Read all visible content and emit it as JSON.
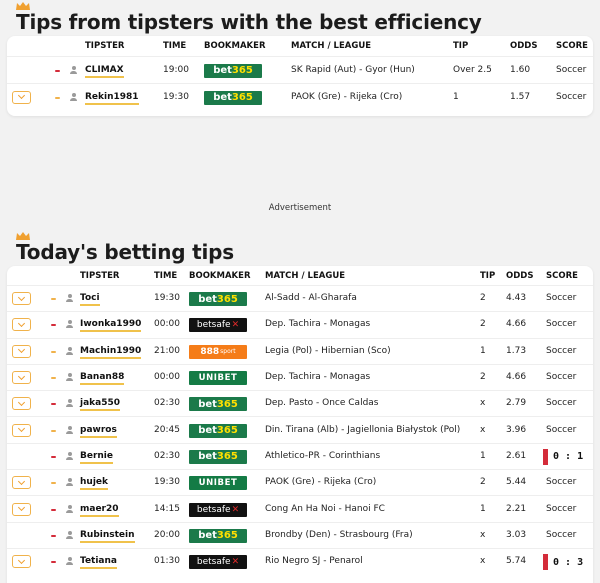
{
  "colors": {
    "accent": "#f0b24b",
    "underline": "#f0c24b",
    "trend_down": "#d42c3a",
    "bet365": "#1b7a4a",
    "betsafe": "#111111",
    "b888": "#f57c18",
    "unibet": "#147b45",
    "score_bar": "#d42c3a"
  },
  "top": {
    "title": "Tips from tipsters with the best efficiency",
    "headers": {
      "tipster": "TIPSTER",
      "time": "TIME",
      "bookmaker": "BOOKMAKER",
      "match": "MATCH / LEAGUE",
      "tip": "TIP",
      "odds": "ODDS",
      "score": "SCORE"
    },
    "rows": [
      {
        "follow": false,
        "trend": "down",
        "tipster": "CLIMAX",
        "time": "19:00",
        "bookmaker": "bet365",
        "match": "SK Rapid (Aut) - Gyor (Hun)",
        "tip": "Over 2.5",
        "odds": "1.60",
        "score": "Soccer",
        "score_result": ""
      },
      {
        "follow": true,
        "trend": "up",
        "tipster": "Rekin1981",
        "time": "19:30",
        "bookmaker": "bet365",
        "match": "PAOK (Gre) - Rijeka (Cro)",
        "tip": "1",
        "odds": "1.57",
        "score": "Soccer",
        "score_result": ""
      }
    ]
  },
  "advertisement": "Advertisement",
  "today": {
    "title": "Today's betting tips",
    "headers": {
      "tipster": "TIPSTER",
      "time": "TIME",
      "bookmaker": "BOOKMAKER",
      "match": "MATCH / LEAGUE",
      "tip": "TIP",
      "odds": "ODDS",
      "score": "SCORE"
    },
    "rows": [
      {
        "follow": true,
        "trend": "up",
        "tipster": "Toci",
        "time": "19:30",
        "bookmaker": "bet365",
        "match": "Al-Sadd - Al-Gharafa",
        "tip": "2",
        "odds": "4.43",
        "score": "Soccer",
        "score_result": ""
      },
      {
        "follow": true,
        "trend": "down",
        "tipster": "Iwonka1990",
        "time": "00:00",
        "bookmaker": "betsafe",
        "match": "Dep. Tachira - Monagas",
        "tip": "2",
        "odds": "4.66",
        "score": "Soccer",
        "score_result": ""
      },
      {
        "follow": true,
        "trend": "up",
        "tipster": "Machin1990",
        "time": "21:00",
        "bookmaker": "888",
        "match": "Legia (Pol) - Hibernian (Sco)",
        "tip": "1",
        "odds": "1.73",
        "score": "Soccer",
        "score_result": ""
      },
      {
        "follow": true,
        "trend": "up",
        "tipster": "Banan88",
        "time": "00:00",
        "bookmaker": "unibet",
        "match": "Dep. Tachira - Monagas",
        "tip": "2",
        "odds": "4.66",
        "score": "Soccer",
        "score_result": ""
      },
      {
        "follow": true,
        "trend": "down",
        "tipster": "jaka550",
        "time": "02:30",
        "bookmaker": "bet365",
        "match": "Dep. Pasto - Once Caldas",
        "tip": "x",
        "odds": "2.79",
        "score": "Soccer",
        "score_result": ""
      },
      {
        "follow": true,
        "trend": "up",
        "tipster": "pawros",
        "time": "20:45",
        "bookmaker": "bet365",
        "match": "Din. Tirana (Alb) - Jagiellonia Białystok (Pol)",
        "tip": "x",
        "odds": "3.96",
        "score": "Soccer",
        "score_result": ""
      },
      {
        "follow": false,
        "trend": "down",
        "tipster": "Bernie",
        "time": "02:30",
        "bookmaker": "bet365",
        "match": "Athletico-PR - Corinthians",
        "tip": "1",
        "odds": "2.61",
        "score": "",
        "score_result": "0 : 1"
      },
      {
        "follow": true,
        "trend": "up",
        "tipster": "hujek",
        "time": "19:30",
        "bookmaker": "unibet",
        "match": "PAOK (Gre) - Rijeka (Cro)",
        "tip": "2",
        "odds": "5.44",
        "score": "Soccer",
        "score_result": ""
      },
      {
        "follow": true,
        "trend": "down",
        "tipster": "maer20",
        "time": "14:15",
        "bookmaker": "betsafe",
        "match": "Cong An Ha Noi - Hanoi FC",
        "tip": "1",
        "odds": "2.21",
        "score": "Soccer",
        "score_result": ""
      },
      {
        "follow": false,
        "trend": "down",
        "tipster": "Rubinstein",
        "time": "20:00",
        "bookmaker": "bet365",
        "match": "Brondby (Den) - Strasbourg (Fra)",
        "tip": "x",
        "odds": "3.03",
        "score": "Soccer",
        "score_result": ""
      },
      {
        "follow": true,
        "trend": "down",
        "tipster": "Tetiana",
        "time": "01:30",
        "bookmaker": "betsafe",
        "match": "Rio Negro SJ - Penarol",
        "tip": "x",
        "odds": "5.74",
        "score": "",
        "score_result": "0 : 3"
      }
    ]
  }
}
